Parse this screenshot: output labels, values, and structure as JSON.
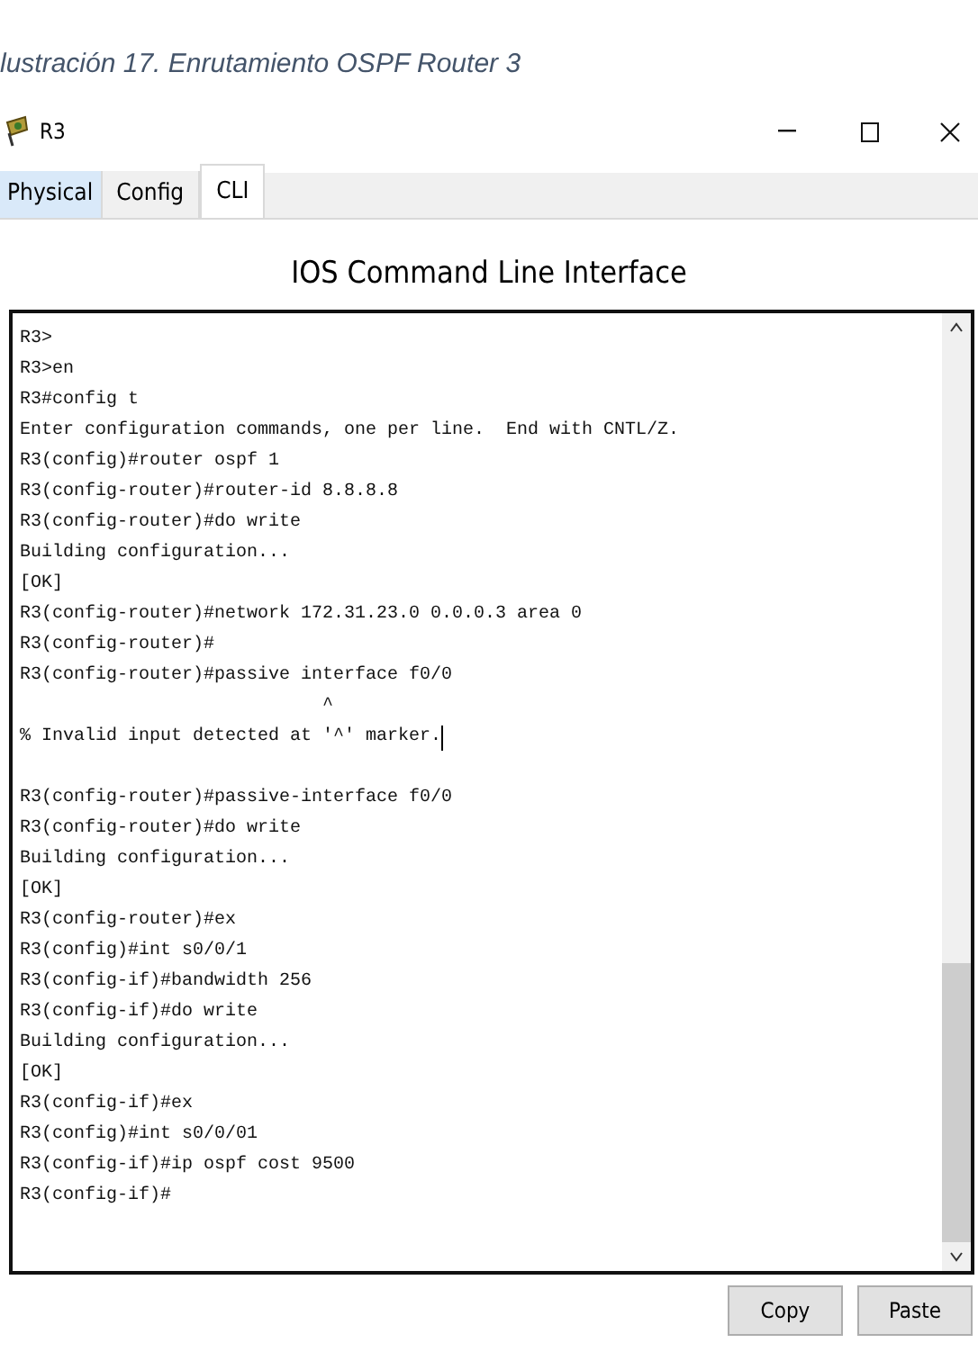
{
  "caption": "lustración 17. Enrutamiento OSPF Router 3",
  "window": {
    "title": "R3"
  },
  "tabs": [
    {
      "label": "Physical",
      "selected": false,
      "hovered": true
    },
    {
      "label": "Config",
      "selected": false,
      "hovered": false
    },
    {
      "label": "CLI",
      "selected": true,
      "hovered": false
    }
  ],
  "heading": "IOS Command Line Interface",
  "terminal": {
    "lines": [
      {
        "kind": "text",
        "text": "R3>"
      },
      {
        "kind": "text",
        "text": "R3>en"
      },
      {
        "kind": "text",
        "text": "R3#config t"
      },
      {
        "kind": "text",
        "text": "Enter configuration commands, one per line.  End with CNTL/Z."
      },
      {
        "kind": "text",
        "text": "R3(config)#router ospf 1"
      },
      {
        "kind": "text",
        "text": "R3(config-router)#router-id 8.8.8.8"
      },
      {
        "kind": "text",
        "text": "R3(config-router)#do write"
      },
      {
        "kind": "text",
        "text": "Building configuration..."
      },
      {
        "kind": "text",
        "text": "[OK]"
      },
      {
        "kind": "text",
        "text": "R3(config-router)#network 172.31.23.0 0.0.0.3 area 0"
      },
      {
        "kind": "text",
        "text": "R3(config-router)#"
      },
      {
        "kind": "text",
        "text": "R3(config-router)#passive interface f0/0"
      },
      {
        "kind": "text",
        "text": "                            ^"
      },
      {
        "kind": "cursor",
        "text": "% Invalid input detected at '^' marker."
      },
      {
        "kind": "blank"
      },
      {
        "kind": "text",
        "text": "R3(config-router)#passive-interface f0/0"
      },
      {
        "kind": "text",
        "text": "R3(config-router)#do write"
      },
      {
        "kind": "text",
        "text": "Building configuration..."
      },
      {
        "kind": "text",
        "text": "[OK]"
      },
      {
        "kind": "text",
        "text": "R3(config-router)#ex"
      },
      {
        "kind": "text",
        "text": "R3(config)#int s0/0/1"
      },
      {
        "kind": "text",
        "text": "R3(config-if)#bandwidth 256"
      },
      {
        "kind": "text",
        "text": "R3(config-if)#do write"
      },
      {
        "kind": "text",
        "text": "Building configuration..."
      },
      {
        "kind": "text",
        "text": "[OK]"
      },
      {
        "kind": "text",
        "text": "R3(config-if)#ex"
      },
      {
        "kind": "text",
        "text": "R3(config)#int s0/0/01"
      },
      {
        "kind": "text",
        "text": "R3(config-if)#ip ospf cost 9500"
      },
      {
        "kind": "text",
        "text": "R3(config-if)#"
      }
    ]
  },
  "buttons": [
    {
      "label": "Copy"
    },
    {
      "label": "Paste"
    }
  ]
}
